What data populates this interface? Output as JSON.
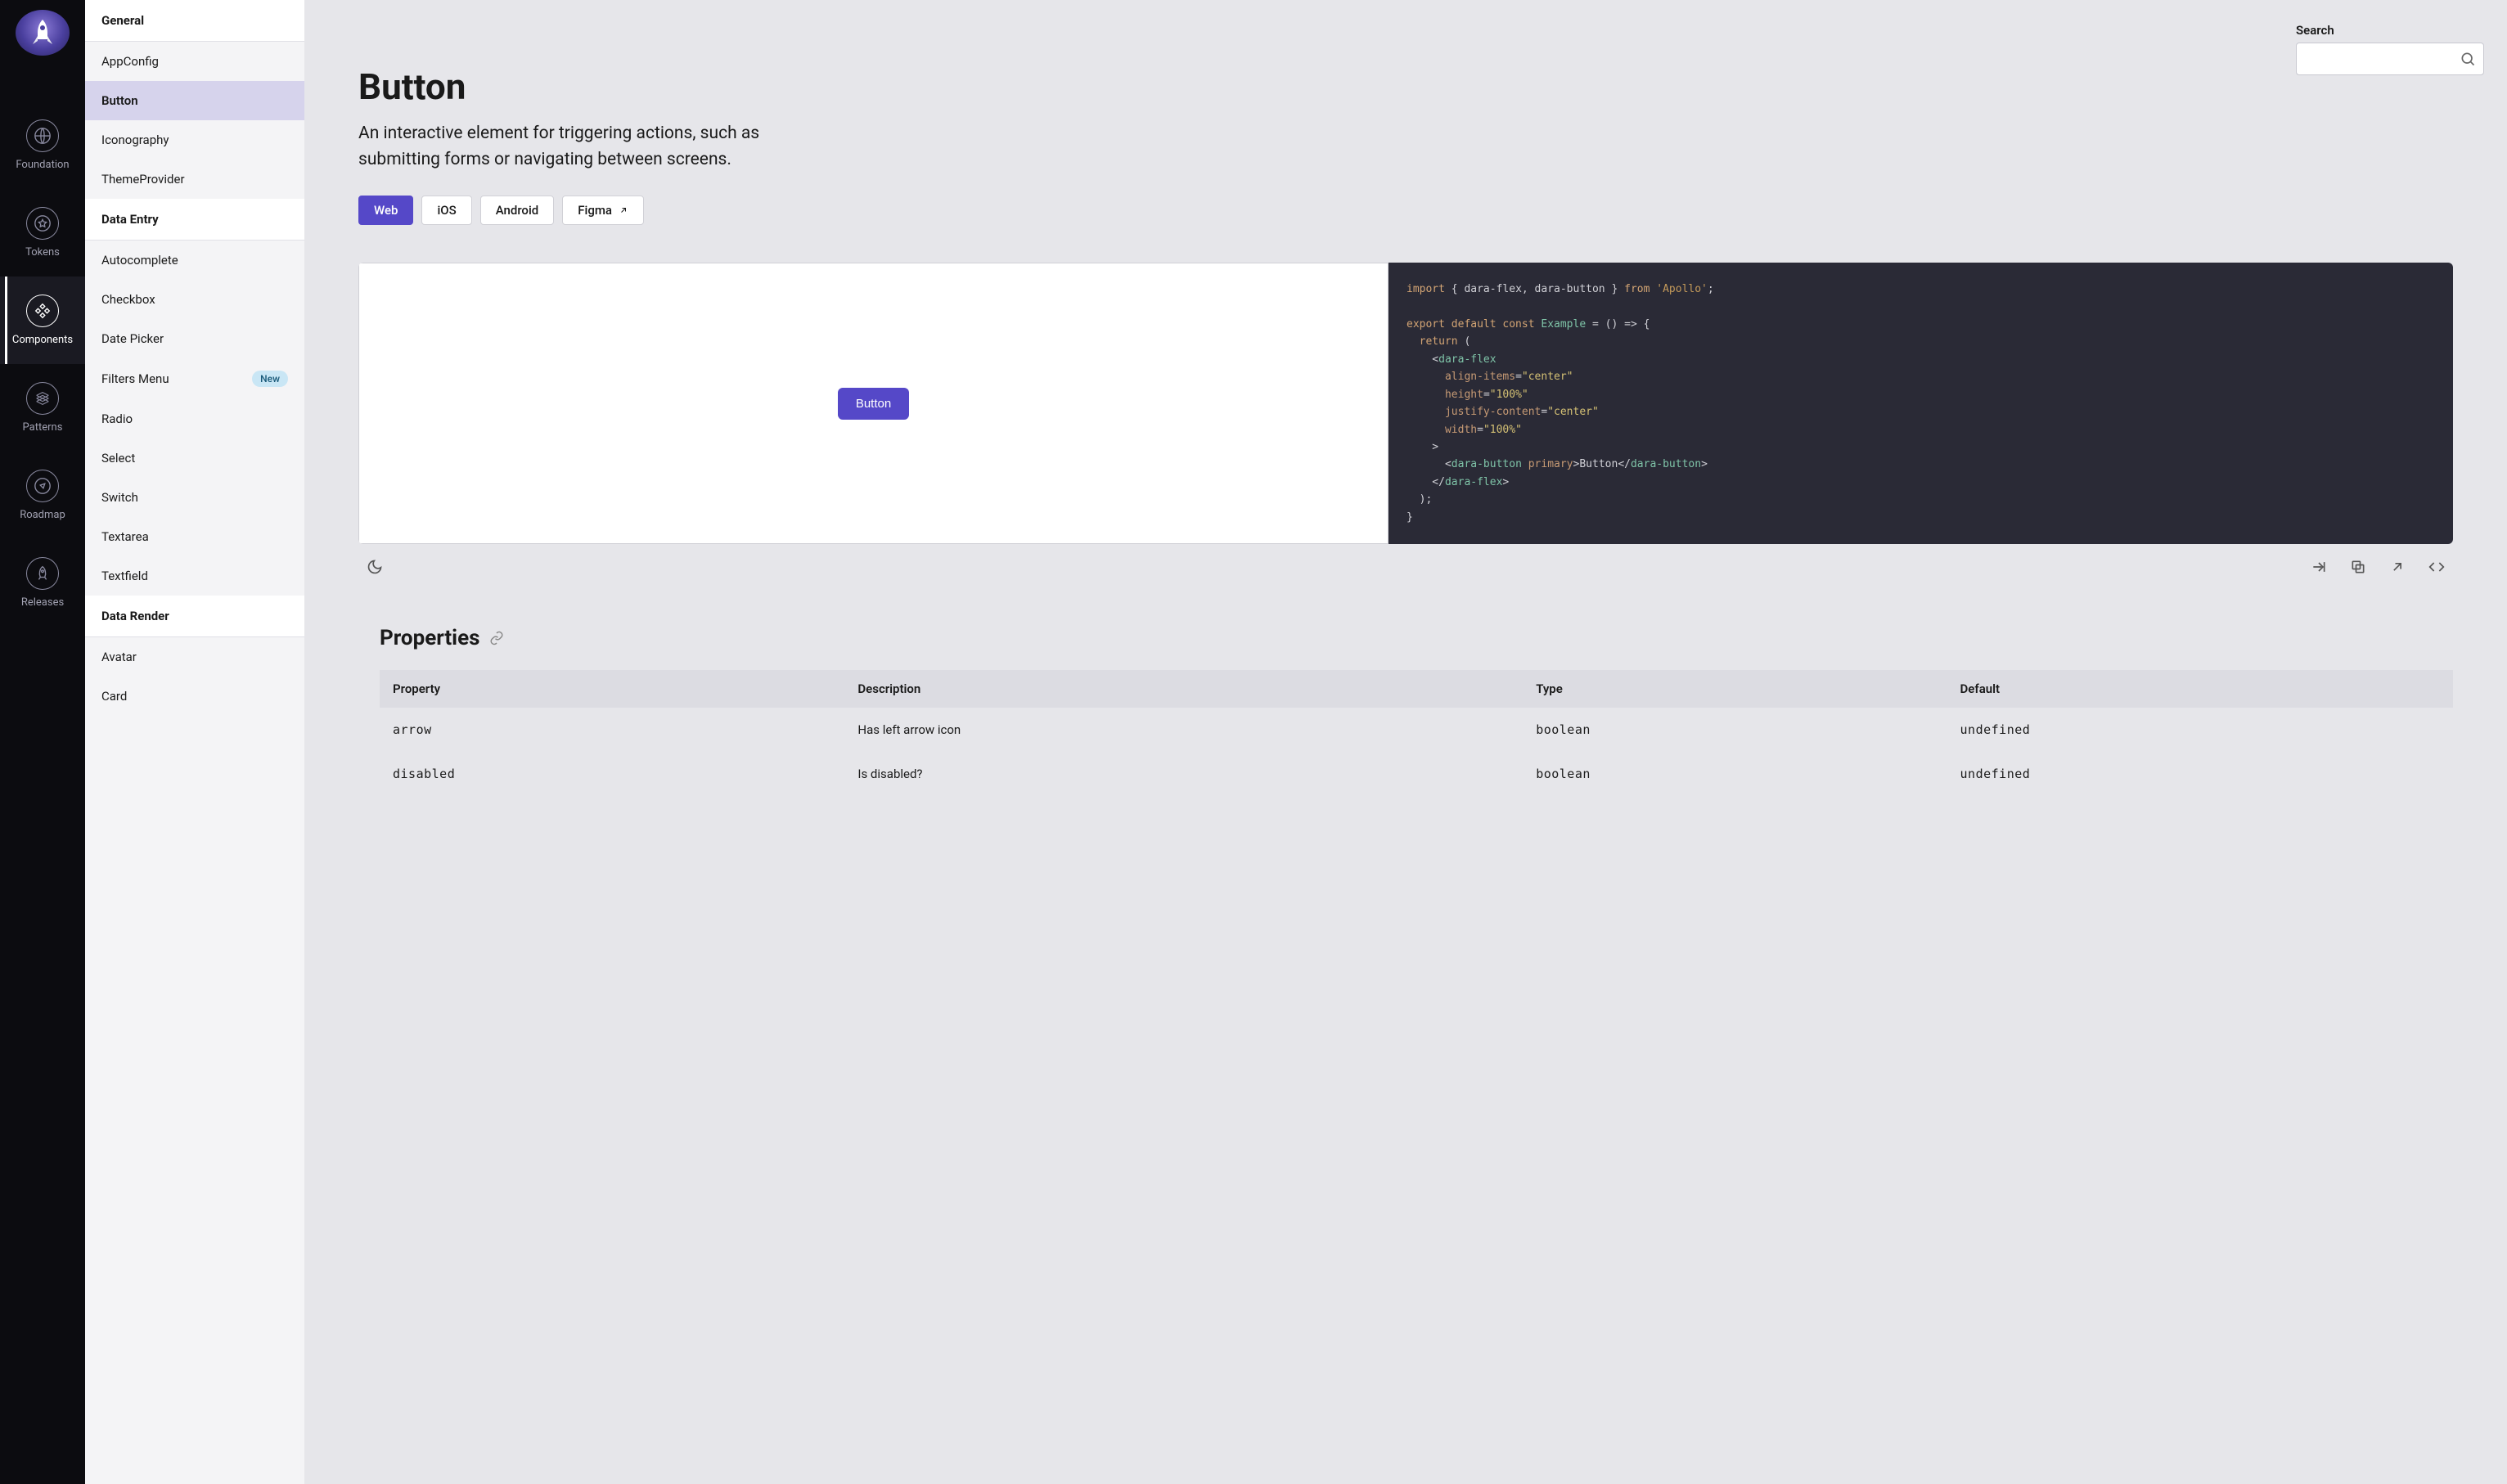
{
  "nav": {
    "items": [
      {
        "label": "Foundation"
      },
      {
        "label": "Tokens"
      },
      {
        "label": "Components"
      },
      {
        "label": "Patterns"
      },
      {
        "label": "Roadmap"
      },
      {
        "label": "Releases"
      }
    ]
  },
  "sidebar": {
    "groups": [
      {
        "header": "General",
        "items": [
          {
            "label": "AppConfig"
          },
          {
            "label": "Button"
          },
          {
            "label": "Iconography"
          },
          {
            "label": "ThemeProvider"
          }
        ]
      },
      {
        "header": "Data Entry",
        "items": [
          {
            "label": "Autocomplete"
          },
          {
            "label": "Checkbox"
          },
          {
            "label": "Date Picker"
          },
          {
            "label": "Filters Menu",
            "badge": "New"
          },
          {
            "label": "Radio"
          },
          {
            "label": "Select"
          },
          {
            "label": "Switch"
          },
          {
            "label": "Textarea"
          },
          {
            "label": "Textfield"
          }
        ]
      },
      {
        "header": "Data Render",
        "items": [
          {
            "label": "Avatar"
          },
          {
            "label": "Card"
          }
        ]
      }
    ]
  },
  "search": {
    "label": "Search",
    "value": ""
  },
  "page": {
    "title": "Button",
    "description": "An interactive element for triggering actions, such as submitting forms or navigating between screens."
  },
  "tabs": [
    {
      "label": "Web"
    },
    {
      "label": "iOS"
    },
    {
      "label": "Android"
    },
    {
      "label": "Figma",
      "external": true
    }
  ],
  "demo": {
    "button_label": "Button",
    "code": {
      "import_kw": "import",
      "import_items": "{ dara-flex, dara-button }",
      "from_kw": "from",
      "from_val": "'Apollo'",
      "export_line": "export default const Example = () => {",
      "return_kw": "return",
      "tag_flex": "dara-flex",
      "attr_align": "align-items",
      "val_center": "\"center\"",
      "attr_height": "height",
      "val_100": "\"100%\"",
      "attr_justify": "justify-content",
      "attr_width": "width",
      "tag_button": "dara-button",
      "attr_primary": "primary",
      "button_text": "Button"
    }
  },
  "properties": {
    "heading": "Properties",
    "columns": [
      "Property",
      "Description",
      "Type",
      "Default"
    ],
    "rows": [
      {
        "property": "arrow",
        "description": "Has left arrow icon",
        "type": "boolean",
        "default": "undefined"
      },
      {
        "property": "disabled",
        "description": "Is disabled?",
        "type": "boolean",
        "default": "undefined"
      }
    ]
  }
}
